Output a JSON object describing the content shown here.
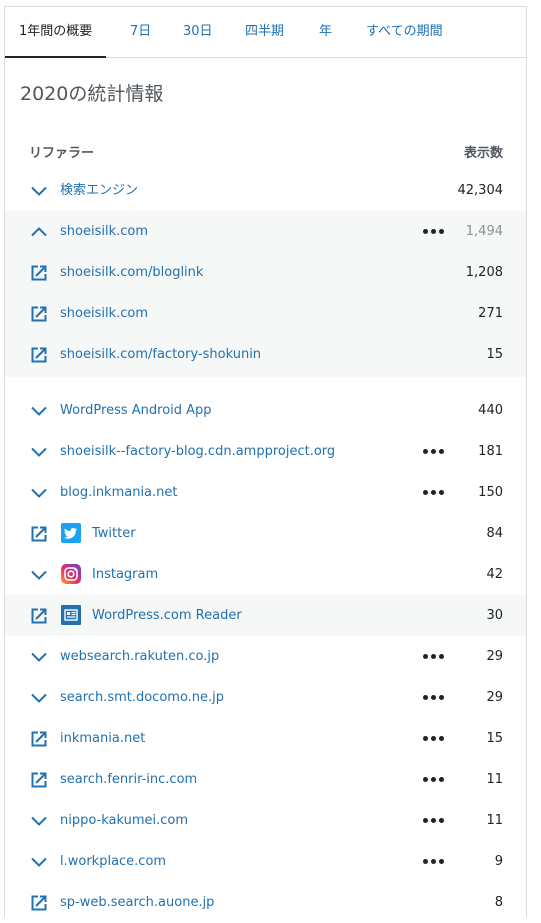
{
  "tabs": [
    {
      "label": "1年間の概要",
      "active": true
    },
    {
      "label": "7日"
    },
    {
      "label": "30日"
    },
    {
      "label": "四半期"
    },
    {
      "label": "年"
    },
    {
      "label": "すべての期間"
    }
  ],
  "title": "2020の統計情報",
  "columns": {
    "referrer": "リファラー",
    "views": "表示数"
  },
  "rows": [
    {
      "icon": "chevron-down-icon",
      "label": "検索エンジン",
      "value": "42,304"
    },
    {
      "icon": "chevron-up-icon",
      "label": "shoeisilk.com",
      "value": "1,494",
      "more": true
    },
    {
      "icon": "external-link-icon",
      "label": "shoeisilk.com/bloglink",
      "value": "1,208"
    },
    {
      "icon": "external-link-icon",
      "label": "shoeisilk.com",
      "value": "271"
    },
    {
      "icon": "external-link-icon",
      "label": "shoeisilk.com/factory-shokunin",
      "value": "15"
    },
    {
      "icon": "chevron-down-icon",
      "label": "WordPress Android App",
      "value": "440"
    },
    {
      "icon": "chevron-down-icon",
      "label": "shoeisilk--factory-blog.cdn.ampproject.org",
      "value": "181",
      "more": true
    },
    {
      "icon": "chevron-down-icon",
      "label": "blog.inkmania.net",
      "value": "150",
      "more": true
    },
    {
      "icon": "external-link-icon",
      "logo": "twitter-logo-icon",
      "label": "Twitter",
      "value": "84"
    },
    {
      "icon": "chevron-down-icon",
      "logo": "instagram-logo-icon",
      "label": "Instagram",
      "value": "42"
    },
    {
      "icon": "external-link-icon",
      "logo": "reader-logo-icon",
      "label": "WordPress.com Reader",
      "value": "30"
    },
    {
      "icon": "chevron-down-icon",
      "label": "websearch.rakuten.co.jp",
      "value": "29",
      "more": true
    },
    {
      "icon": "chevron-down-icon",
      "label": "search.smt.docomo.ne.jp",
      "value": "29",
      "more": true
    },
    {
      "icon": "external-link-icon",
      "label": "inkmania.net",
      "value": "15",
      "more": true
    },
    {
      "icon": "external-link-icon",
      "label": "search.fenrir-inc.com",
      "value": "11",
      "more": true
    },
    {
      "icon": "chevron-down-icon",
      "label": "nippo-kakumei.com",
      "value": "11",
      "more": true
    },
    {
      "icon": "chevron-down-icon",
      "label": "l.workplace.com",
      "value": "9",
      "more": true
    },
    {
      "icon": "external-link-icon",
      "label": "sp-web.search.auone.jp",
      "value": "8"
    }
  ],
  "colors": {
    "link": "#2271b1",
    "text": "#1d2327",
    "muted": "#8c8f94",
    "shade": "#f6f7f7"
  }
}
